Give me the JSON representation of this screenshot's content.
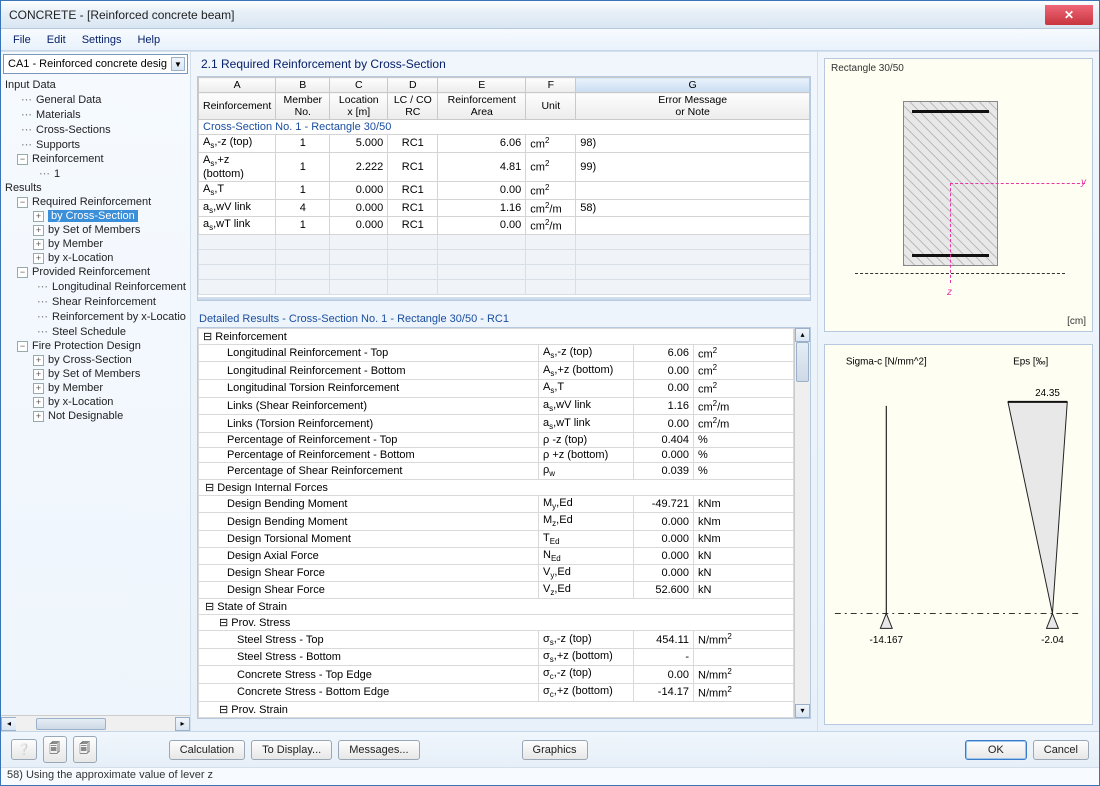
{
  "window": {
    "title": "CONCRETE - [Reinforced concrete beam]"
  },
  "menu": {
    "file": "File",
    "edit": "Edit",
    "settings": "Settings",
    "help": "Help"
  },
  "combo": {
    "text": "CA1 - Reinforced concrete desig"
  },
  "tree": {
    "root1": "Input Data",
    "r1a": "General Data",
    "r1b": "Materials",
    "r1c": "Cross-Sections",
    "r1d": "Supports",
    "r1e": "Reinforcement",
    "r1e1": "1",
    "root2": "Results",
    "r2a": "Required Reinforcement",
    "r2a1": "by Cross-Section",
    "r2a2": "by Set of Members",
    "r2a3": "by Member",
    "r2a4": "by x-Location",
    "r2b": "Provided Reinforcement",
    "r2b1": "Longitudinal Reinforcement",
    "r2b2": "Shear Reinforcement",
    "r2b3": "Reinforcement by x-Locatio",
    "r2b4": "Steel Schedule",
    "r2c": "Fire Protection Design",
    "r2c1": "by Cross-Section",
    "r2c2": "by Set of Members",
    "r2c3": "by Member",
    "r2c4": "by x-Location",
    "r2c5": "Not Designable"
  },
  "section": {
    "title": "2.1 Required Reinforcement by Cross-Section"
  },
  "cols": {
    "A": "A",
    "B": "B",
    "C": "C",
    "D": "D",
    "E": "E",
    "F": "F",
    "G": "G",
    "reinf": "Reinforcement",
    "memno": "Member\nNo.",
    "loc": "Location\nx [m]",
    "lc": "LC / CO\nRC",
    "area": "Reinforcement\nArea",
    "unit": "Unit",
    "err": "Error Message\nor Note"
  },
  "tabSection": "Cross-Section No. 1 - Rectangle 30/50",
  "rows": [
    {
      "a": "A_s,-z (top)",
      "b": "1",
      "c": "5.000",
      "d": "RC1",
      "e": "6.06",
      "f": "cm²",
      "g": "98)"
    },
    {
      "a": "A_s,+z (bottom)",
      "b": "1",
      "c": "2.222",
      "d": "RC1",
      "e": "4.81",
      "f": "cm²",
      "g": "99)"
    },
    {
      "a": "A_s,T",
      "b": "1",
      "c": "0.000",
      "d": "RC1",
      "e": "0.00",
      "f": "cm²",
      "g": ""
    },
    {
      "a": "a_s,wV link",
      "b": "4",
      "c": "0.000",
      "d": "RC1",
      "e": "1.16",
      "f": "cm²/m",
      "g": "58)"
    },
    {
      "a": "a_s,wT link",
      "b": "1",
      "c": "0.000",
      "d": "RC1",
      "e": "0.00",
      "f": "cm²/m",
      "g": ""
    }
  ],
  "details": {
    "title": "Detailed Results  -  Cross-Section No. 1 - Rectangle 30/50  -  RC1",
    "g1": "Reinforcement",
    "g1r": [
      {
        "n": "Longitudinal Reinforcement - Top",
        "s": "A_s,-z (top)",
        "v": "6.06",
        "u": "cm²"
      },
      {
        "n": "Longitudinal Reinforcement - Bottom",
        "s": "A_s,+z (bottom)",
        "v": "0.00",
        "u": "cm²"
      },
      {
        "n": "Longitudinal Torsion Reinforcement",
        "s": "A_s,T",
        "v": "0.00",
        "u": "cm²"
      },
      {
        "n": "Links (Shear Reinforcement)",
        "s": "a_s,wV link",
        "v": "1.16",
        "u": "cm²/m"
      },
      {
        "n": "Links (Torsion Reinforcement)",
        "s": "a_s,wT link",
        "v": "0.00",
        "u": "cm²/m"
      },
      {
        "n": "Percentage of Reinforcement - Top",
        "s": "ρ -z (top)",
        "v": "0.404",
        "u": "%"
      },
      {
        "n": "Percentage of Reinforcement - Bottom",
        "s": "ρ +z (bottom)",
        "v": "0.000",
        "u": "%"
      },
      {
        "n": "Percentage of Shear Reinforcement",
        "s": "ρ_w",
        "v": "0.039",
        "u": "%"
      }
    ],
    "g2": "Design Internal Forces",
    "g2r": [
      {
        "n": "Design Bending Moment",
        "s": "M_y,Ed",
        "v": "-49.721",
        "u": "kNm"
      },
      {
        "n": "Design Bending Moment",
        "s": "M_z,Ed",
        "v": "0.000",
        "u": "kNm"
      },
      {
        "n": "Design Torsional Moment",
        "s": "T_Ed",
        "v": "0.000",
        "u": "kNm"
      },
      {
        "n": "Design Axial Force",
        "s": "N_Ed",
        "v": "0.000",
        "u": "kN"
      },
      {
        "n": "Design Shear Force",
        "s": "V_y,Ed",
        "v": "0.000",
        "u": "kN"
      },
      {
        "n": "Design Shear Force",
        "s": "V_z,Ed",
        "v": "52.600",
        "u": "kN"
      }
    ],
    "g3": "State of Strain",
    "g3a": "Prov. Stress",
    "g3ar": [
      {
        "n": "Steel Stress - Top",
        "s": "σ_s,-z (top)",
        "v": "454.11",
        "u": "N/mm²"
      },
      {
        "n": "Steel Stress - Bottom",
        "s": "σ_s,+z (bottom)",
        "v": "-",
        "u": ""
      },
      {
        "n": "Concrete Stress - Top Edge",
        "s": "σ_c,-z (top)",
        "v": "0.00",
        "u": "N/mm²"
      },
      {
        "n": "Concrete Stress - Bottom Edge",
        "s": "σ_c,+z (bottom)",
        "v": "-14.17",
        "u": "N/mm²"
      }
    ],
    "g3b": "Prov. Strain"
  },
  "preview": {
    "title": "Rectangle 30/50",
    "cm": "[cm]",
    "y": "y",
    "z": "z"
  },
  "chart_data": {
    "type": "line",
    "title_left": "Sigma-c [N/mm^2]",
    "title_right": "Eps [‰]",
    "left": {
      "bottom_value": -14.167,
      "top_value": 0
    },
    "right": {
      "bottom_value": -2.04,
      "top_value": 24.35
    }
  },
  "buttons": {
    "calc": "Calculation",
    "disp": "To Display...",
    "msg": "Messages...",
    "gfx": "Graphics",
    "ok": "OK",
    "cancel": "Cancel"
  },
  "status": "58) Using the approximate value of lever z"
}
